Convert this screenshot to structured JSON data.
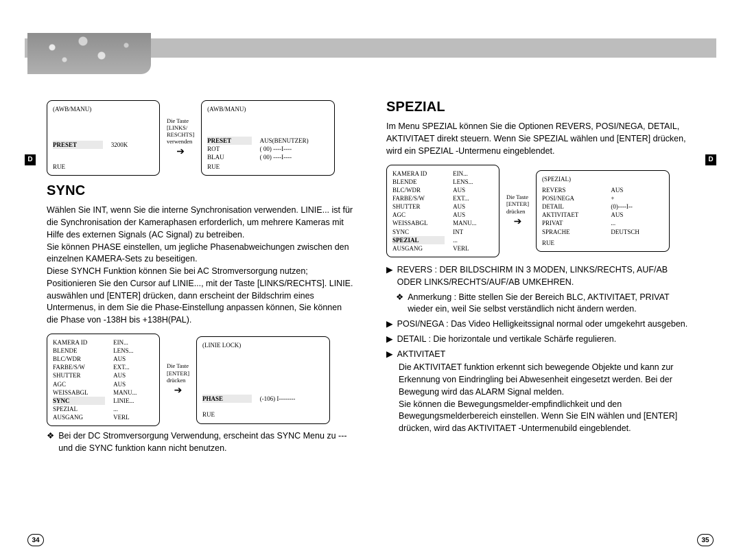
{
  "side_tab": "D",
  "page_left": "34",
  "page_right": "35",
  "left": {
    "osd1": {
      "title": "(AWB/MANU)",
      "rows": [
        [
          "PRESET",
          "3200K"
        ]
      ],
      "footer": "RUE"
    },
    "arrow1": "Die Taste\n[LINKS/\nRESCHTS]\nverwenden",
    "osd2": {
      "title": "(AWB/MANU)",
      "rows": [
        [
          "PRESET",
          "AUS(BENUTZER)"
        ],
        [
          "ROT",
          "( 00) ----I----"
        ],
        [
          "BLAU",
          "( 00) ----I----"
        ]
      ],
      "footer": "RUE"
    },
    "heading_sync": "SYNC",
    "sync_body": "Wählen Sie INT, wenn Sie die interne Synchronisation verwenden. LINIE... ist für die Synchronisation der Kameraphasen erforderlich, um mehrere Kameras mit Hilfe des externen Signals (AC Signal) zu betreiben.\nSie können PHASE einstellen, um jegliche Phasenabweichungen zwischen den einzelnen KAMERA-Sets zu beseitigen.\nDiese SYNCH Funktion können Sie bei AC Stromversorgung nutzen;\nPositionieren Sie den Cursor auf LINIE..., mit der Taste [LINKS/RECHTS]. LINIE. auswählen und [ENTER] drücken, dann erscheint der Bildschrim eines Untermenus, in dem Sie die Phase-Einstellung anpassen können, Sie können die Phase von -138H bis +138H(PAL).",
    "osd3_rows": [
      [
        "KAMERA ID",
        "EIN..."
      ],
      [
        "BLENDE",
        "LENS..."
      ],
      [
        "BLC/WDR",
        "AUS"
      ],
      [
        "FARBE/S/W",
        "EXT..."
      ],
      [
        "SHUTTER",
        "AUS"
      ],
      [
        "AGC",
        "AUS"
      ],
      [
        "WEISSABGL",
        "MANU..."
      ],
      [
        "SYNC",
        "LINIE..."
      ],
      [
        "SPEZIAL",
        "..."
      ],
      [
        "AUSGANG",
        "VERL"
      ]
    ],
    "arrow2": "Die Taste\n[ENTER]\ndrücken",
    "osd4": {
      "title": "(LINIE LOCK)",
      "rows": [
        [
          "PHASE",
          "(-106) I--------"
        ]
      ],
      "footer": "RUE"
    },
    "note": "Bei der DC Stromversorgung Verwendung, erscheint das SYNC Menu zu ---und die SYNC funktion kann nicht benutzen."
  },
  "right": {
    "heading_spezial": "SPEZIAL",
    "spezial_intro": "Im Menu SPEZIAL können Sie die Optionen REVERS, POSI/NEGA, DETAIL, AKTIVITAET direkt steuern. Wenn Sie SPEZIAL wählen und [ENTER] drücken, wird ein SPEZIAL -Untermenu eingeblendet.",
    "osd5_rows": [
      [
        "KAMERA ID",
        "EIN..."
      ],
      [
        "BLENDE",
        "LENS..."
      ],
      [
        "BLC/WDR",
        "AUS"
      ],
      [
        "FARBE/S/W",
        "EXT..."
      ],
      [
        "SHUTTER",
        "AUS"
      ],
      [
        "AGC",
        "AUS"
      ],
      [
        "WEISSABGL",
        "MANU..."
      ],
      [
        "SYNC",
        "INT"
      ],
      [
        "SPEZIAL",
        "..."
      ],
      [
        "AUSGANG",
        "VERL"
      ]
    ],
    "arrow3": "Die Taste\n[ENTER]\ndrücken",
    "osd6": {
      "title": "(SPEZIAL)",
      "rows": [
        [
          "REVERS",
          "AUS"
        ],
        [
          "POSI/NEGA",
          "+"
        ],
        [
          "DETAIL",
          "(0)----I--"
        ],
        [
          "AKTIVITAET",
          "AUS"
        ],
        [
          "PRIVAT",
          "..."
        ],
        [
          "SPRACHE",
          "DEUTSCH"
        ]
      ],
      "footer": "RUE"
    },
    "b_revers": "REVERS : DER BILDSCHIRM IN 3 MODEN, LINKS/RECHTS, AUF/AB ODER LINKS/RECHTS/AUF/AB UMKEHREN.",
    "b_anmerkung": "Anmerkung : Bitte stellen Sie der Bereich BLC, AKTIVITAET, PRIVAT wieder ein,  weil Sie selbst verständlich nicht ändern werden.",
    "b_posinega": "POSI/NEGA : Das Video Helligkeitssignal normal oder umgekehrt ausgeben.",
    "b_detail": "DETAIL : Die horizontale und vertikale Schärfe regulieren.",
    "b_aktivitaet": "AKTIVITAET",
    "aktivitaet_body": "Die AKTIVITAET funktion erkennt sich bewegende Objekte und kann zur Erkennung von Eindringling bei Abwesenheit eingesetzt werden. Bei der Bewegung wird das ALARM Signal melden.\nSie können die Bewegungsmelder-empfindlichkeit und den Bewegungsmelderbereich einstellen. Wenn Sie EIN wählen und [ENTER] drücken, wird das  AKTIVITAET -Untermenubild eingeblendet."
  }
}
